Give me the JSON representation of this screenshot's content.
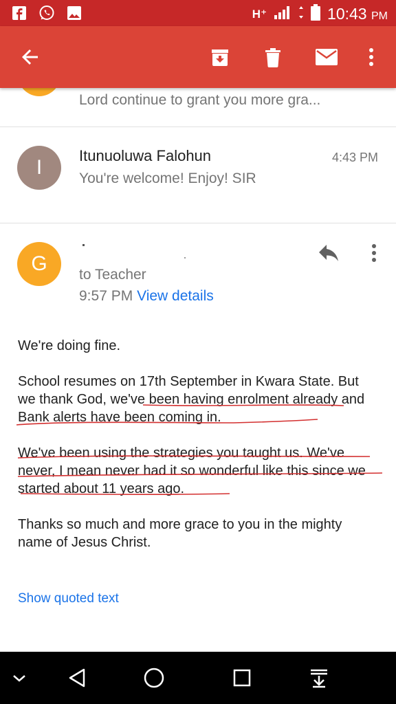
{
  "status_bar": {
    "network": "H⁺",
    "time": "10:43",
    "ampm": "PM"
  },
  "thread": {
    "previous_snippet": "Lord continue to grant you more gra...",
    "reply": {
      "avatar_letter": "I",
      "sender": "Itunuoluwa Falohun",
      "time": "4:43 PM",
      "snippet": "You're welcome! Enjoy! SIR",
      "avatar_color": "#a1887f"
    },
    "message": {
      "avatar_letter": "G",
      "avatar_color": "#f9a825",
      "recipient": "to Teacher",
      "time": "9:57 PM",
      "view_details": "View details",
      "paragraphs": [
        "We're doing fine.",
        "School resumes on 17th September in Kwara State. But we thank God, we've been having enrolment already and Bank alerts have been coming in.",
        "We've been using the strategies you taught us. We've never, I mean never had it so wonderful like this since we started about 11 years ago.",
        "Thanks so much and more grace to you in the mighty name of Jesus Christ."
      ],
      "show_quoted": "Show quoted text"
    }
  },
  "colors": {
    "toolbar": "#db4437",
    "status_bar": "#c62828",
    "link": "#1a73e8",
    "underline": "#d32f2f"
  }
}
